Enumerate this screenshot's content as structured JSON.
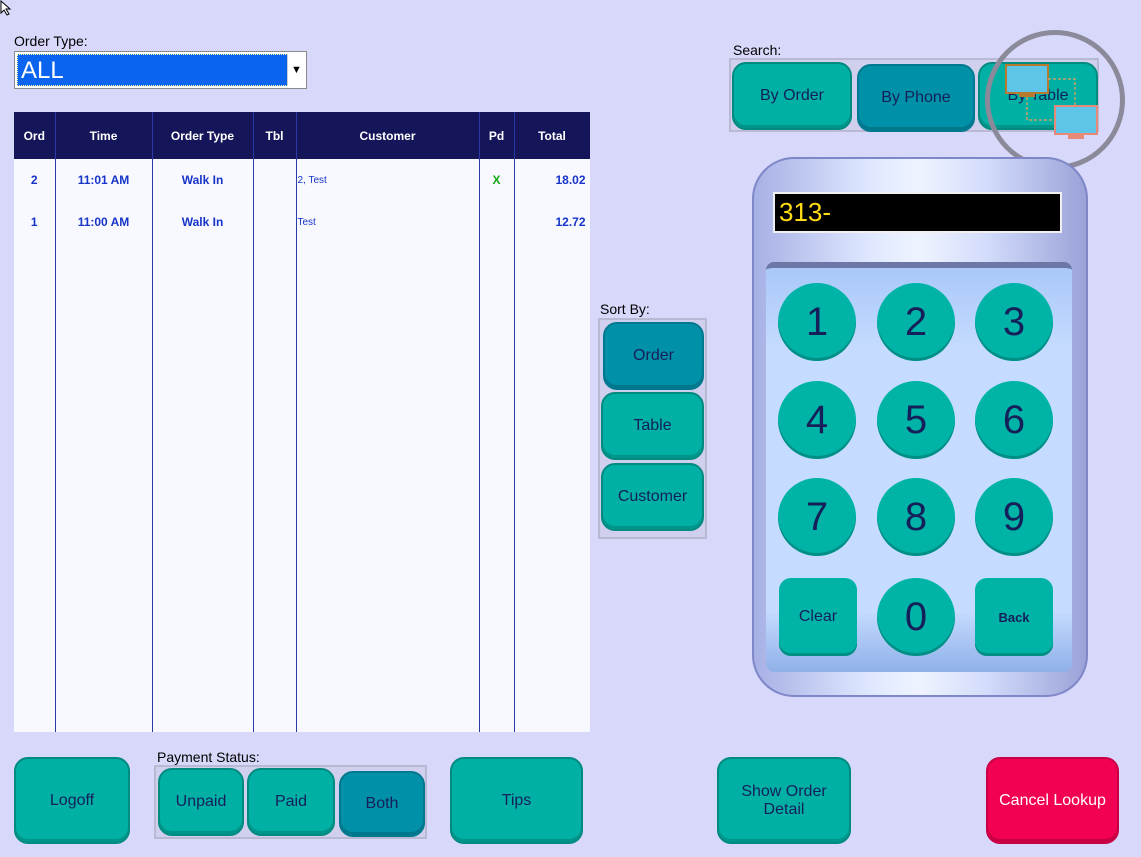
{
  "order_type": {
    "label": "Order Type:",
    "value": "ALL"
  },
  "table": {
    "headers": [
      "Ord",
      "Time",
      "Order Type",
      "Tbl",
      "Customer",
      "Pd",
      "Total"
    ],
    "rows": [
      {
        "ord": "2",
        "time": "11:01 AM",
        "type": "Walk In",
        "tbl": "",
        "customer": "2, Test",
        "pd": "X",
        "total": "18.02"
      },
      {
        "ord": "1",
        "time": "11:00 AM",
        "type": "Walk In",
        "tbl": "",
        "customer": "Test",
        "pd": "",
        "total": "12.72"
      }
    ]
  },
  "sort": {
    "label": "Sort By:",
    "options": [
      "Order",
      "Table",
      "Customer"
    ],
    "selected": "Order"
  },
  "search": {
    "label": "Search:",
    "options": [
      "By Order",
      "By Phone",
      "By Table"
    ],
    "selected": "By Phone"
  },
  "keypad": {
    "display": "313-",
    "keys": [
      "1",
      "2",
      "3",
      "4",
      "5",
      "6",
      "7",
      "8",
      "9",
      "Clear",
      "0",
      "Back"
    ]
  },
  "payment": {
    "label": "Payment Status:",
    "options": [
      "Unpaid",
      "Paid",
      "Both"
    ],
    "selected": "Both"
  },
  "buttons": {
    "logoff": "Logoff",
    "tips": "Tips",
    "show_detail": "Show Order Detail",
    "cancel": "Cancel Lookup"
  },
  "colors": {
    "button": "#00b0a4",
    "button_selected": "#0090a8",
    "cancel": "#f20052",
    "header": "#15165a",
    "background": "#d8d8fa"
  }
}
